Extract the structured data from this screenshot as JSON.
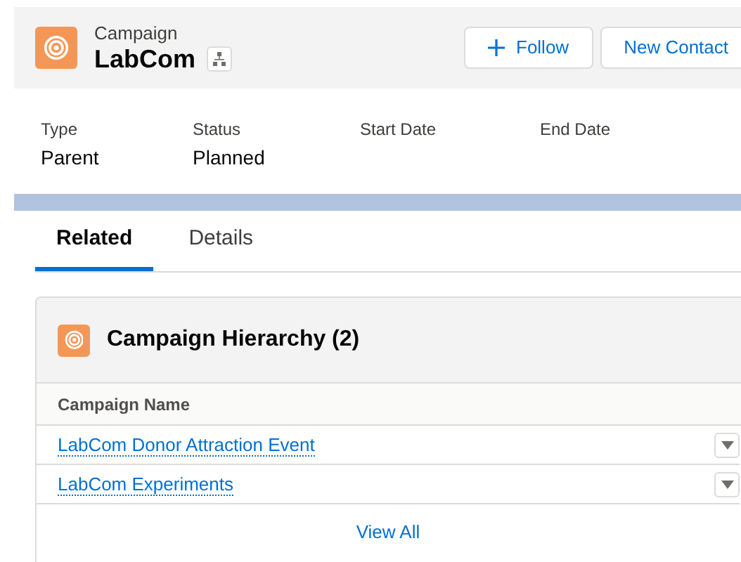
{
  "header": {
    "object_type": "Campaign",
    "title": "LabCom",
    "actions": [
      "Follow",
      "New Contact"
    ]
  },
  "fields": [
    {
      "label": "Type",
      "value": "Parent"
    },
    {
      "label": "Status",
      "value": "Planned"
    },
    {
      "label": "Start Date"
    },
    {
      "label": "End Date"
    }
  ],
  "tabs": [
    {
      "label": "Related",
      "selected": true
    },
    {
      "label": "Details",
      "selected": false
    }
  ],
  "card": {
    "title": "Campaign Hierarchy (2)",
    "columns": [
      "Campaign Name"
    ],
    "rows": [
      {
        "name": "LabCom Donor Attraction Event"
      },
      {
        "name": "LabCom Experiments"
      }
    ],
    "footer_link": "View All"
  }
}
